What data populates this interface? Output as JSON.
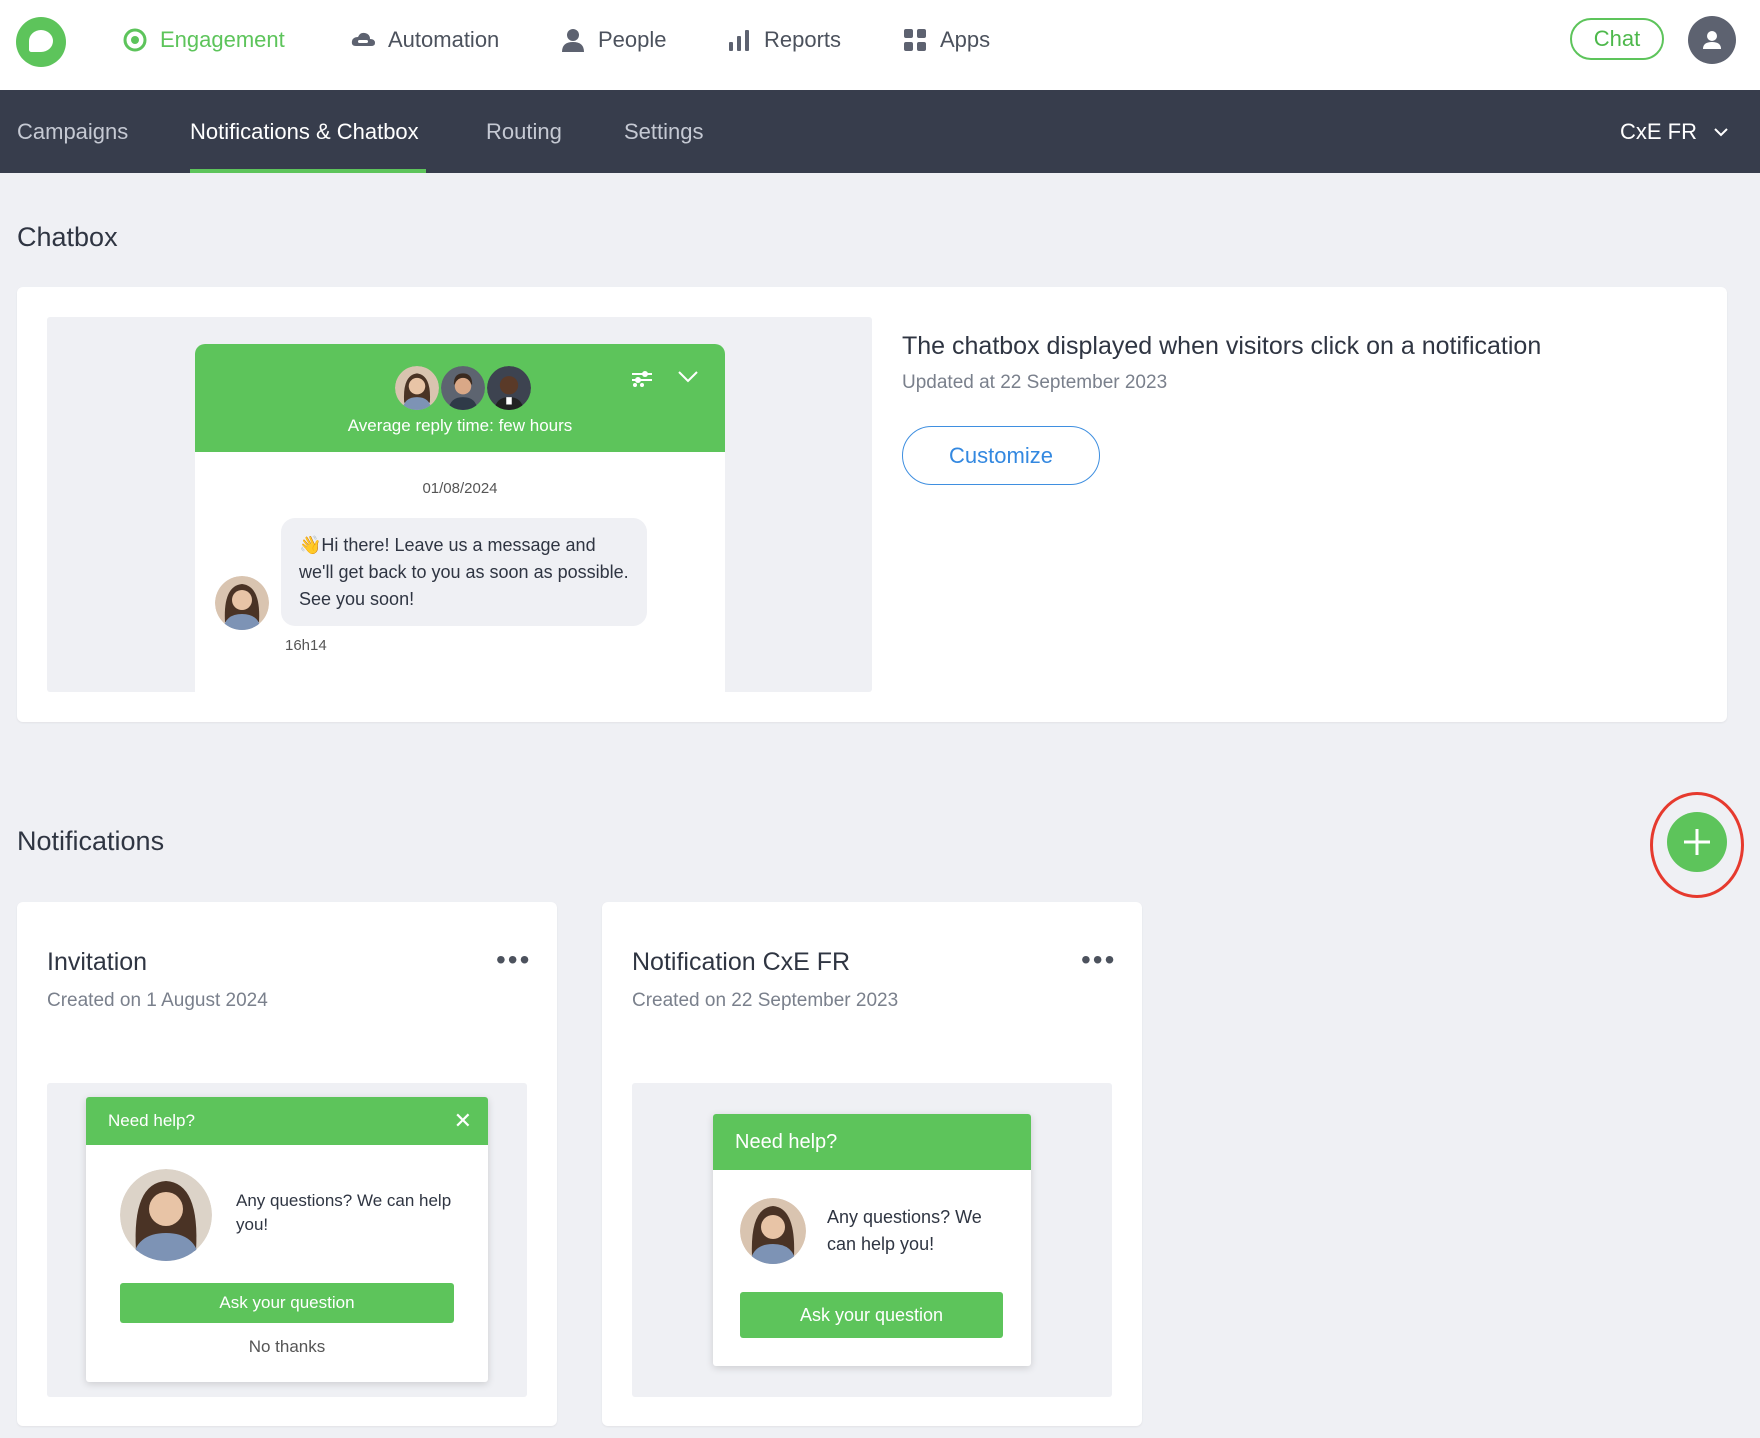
{
  "top_nav": {
    "items": [
      {
        "label": "Engagement",
        "icon": "target-icon"
      },
      {
        "label": "Automation",
        "icon": "cloud-icon"
      },
      {
        "label": "People",
        "icon": "person-icon"
      },
      {
        "label": "Reports",
        "icon": "bar-chart-icon"
      },
      {
        "label": "Apps",
        "icon": "grid-icon"
      }
    ],
    "chat_label": "Chat"
  },
  "sub_nav": {
    "items": [
      "Campaigns",
      "Notifications & Chatbox",
      "Routing",
      "Settings"
    ],
    "active": "Notifications & Chatbox",
    "account": "CxE FR"
  },
  "chatbox": {
    "section_title": "Chatbox",
    "preview": {
      "reply_time": "Average reply time: few hours",
      "date": "01/08/2024",
      "message": "👋Hi there! Leave us a message and we'll get back to you as soon as possible. See you soon!",
      "time": "16h14"
    },
    "title": "The chatbox displayed when visitors click on a notification",
    "updated": "Updated at 22 September 2023",
    "customize_label": "Customize"
  },
  "notifications": {
    "section_title": "Notifications",
    "cards": [
      {
        "title": "Invitation",
        "created": "Created on 1 August 2024",
        "popup": {
          "header": "Need help?",
          "text": "Any questions? We can help you!",
          "button": "Ask your question",
          "dismiss": "No thanks"
        }
      },
      {
        "title": "Notification CxE FR",
        "created": "Created on 22 September 2023",
        "popup": {
          "header": "Need help?",
          "text": "Any questions? We can help you!",
          "button": "Ask your question"
        }
      }
    ]
  },
  "colors": {
    "brand_green": "#5dc45b",
    "nav_dark": "#373d4c",
    "link_blue": "#3388e0",
    "highlight_red": "#e63a2e"
  }
}
